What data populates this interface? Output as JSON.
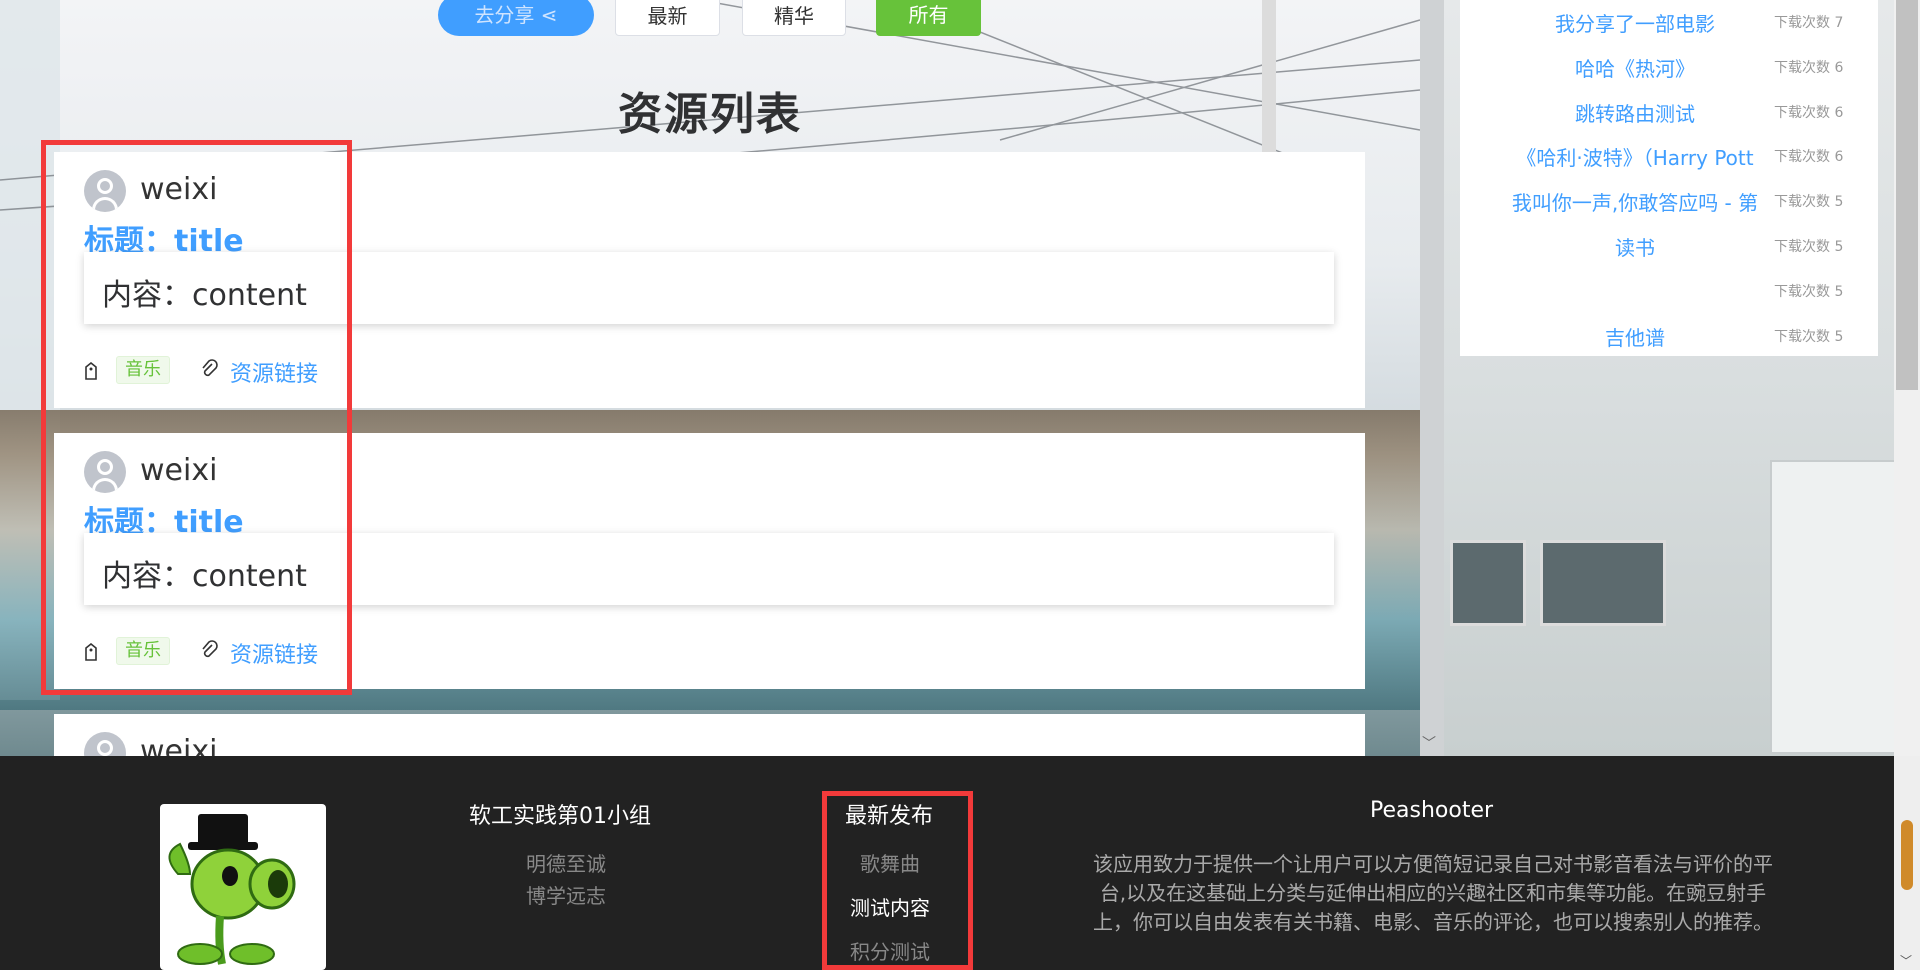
{
  "toolbar": {
    "share_label": "去分享",
    "latest_label": "最新",
    "best_label": "精华",
    "all_label": "所有"
  },
  "page_title": "资源列表",
  "resources": [
    {
      "user": "weixi",
      "title": "标题：title",
      "content": "内容：content",
      "tag": "音乐",
      "link": "资源链接"
    },
    {
      "user": "weixi",
      "title": "标题：title",
      "content": "内容：content",
      "tag": "音乐",
      "link": "资源链接"
    },
    {
      "user": "weixi"
    }
  ],
  "popular": [
    {
      "name": "我分享了一部电影",
      "downloads": "下载次数 7"
    },
    {
      "name": "哈哈《热河》",
      "downloads": "下载次数 6"
    },
    {
      "name": "跳转路由测试",
      "downloads": "下载次数 6"
    },
    {
      "name": "《哈利·波特》（Harry Pott",
      "downloads": "下载次数 6"
    },
    {
      "name": "我叫你一声,你敢答应吗 - 第",
      "downloads": "下载次数 5"
    },
    {
      "name": "读书",
      "downloads": "下载次数 5"
    },
    {
      "name": "",
      "downloads": "下载次数 5"
    },
    {
      "name": "吉他谱",
      "downloads": "下载次数 5"
    }
  ],
  "footer": {
    "group_title": "软工实践第01小组",
    "motto1": "明德至诚",
    "motto2": "博学远志",
    "latest_title": "最新发布",
    "latest_items": [
      "歌舞曲",
      "测试内容",
      "积分测试"
    ],
    "app_title": "Peashooter",
    "app_desc": "该应用致力于提供一个让用户可以方便简短记录自己对书影音看法与评价的平台,以及在这基础上分类与延伸出相应的兴趣社区和市集等功能。在豌豆射手上，你可以自由发表有关书籍、电影、音乐的评论，也可以搜索别人的推荐。"
  }
}
